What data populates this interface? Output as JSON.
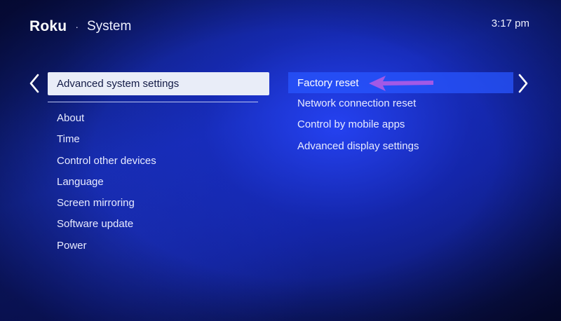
{
  "header": {
    "logo": "Roku",
    "separator": "·",
    "section": "System",
    "time": "3:17 pm"
  },
  "left_menu": {
    "selected": "Advanced system settings",
    "items": [
      "About",
      "Time",
      "Control other devices",
      "Language",
      "Screen mirroring",
      "Software update",
      "Power"
    ]
  },
  "right_menu": {
    "highlighted": "Factory reset",
    "items": [
      "Network connection reset",
      "Control by mobile apps",
      "Advanced display settings"
    ]
  },
  "icons": {
    "left_arrow": "chevron-left-icon",
    "right_arrow": "chevron-right-icon",
    "annotation": "pointer-arrow-icon"
  },
  "colors": {
    "background": "#142ba8",
    "selected_bg": "#e9edf8",
    "highlight_bg": "#2855ff",
    "annotation": "#a259e6"
  }
}
